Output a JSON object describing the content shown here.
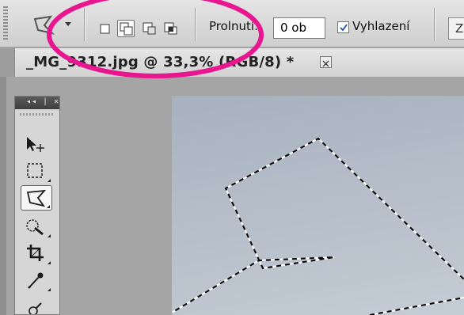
{
  "options_bar": {
    "feather_label": "Prolnutí:",
    "feather_value": "0 ob",
    "antialias_label": "Vyhlazení",
    "antialias_checked": true,
    "extra_button_label": "Z"
  },
  "document": {
    "title": "_MG_9312.jpg @ 33,3% (RGB/8) *"
  },
  "tools_panel": {
    "header_label": "◂◂ | ✕",
    "tools": [
      {
        "name": "move-tool",
        "active": false
      },
      {
        "name": "marquee-tool",
        "active": false
      },
      {
        "name": "polygonal-lasso-tool",
        "active": true
      },
      {
        "name": "quick-selection-tool",
        "active": false
      },
      {
        "name": "crop-tool",
        "active": false
      },
      {
        "name": "eyedropper-tool",
        "active": false
      }
    ]
  },
  "colors": {
    "annotation": "#e8168f",
    "panel": "#d6d6d6",
    "canvas_sky": "#b4bdc8"
  }
}
